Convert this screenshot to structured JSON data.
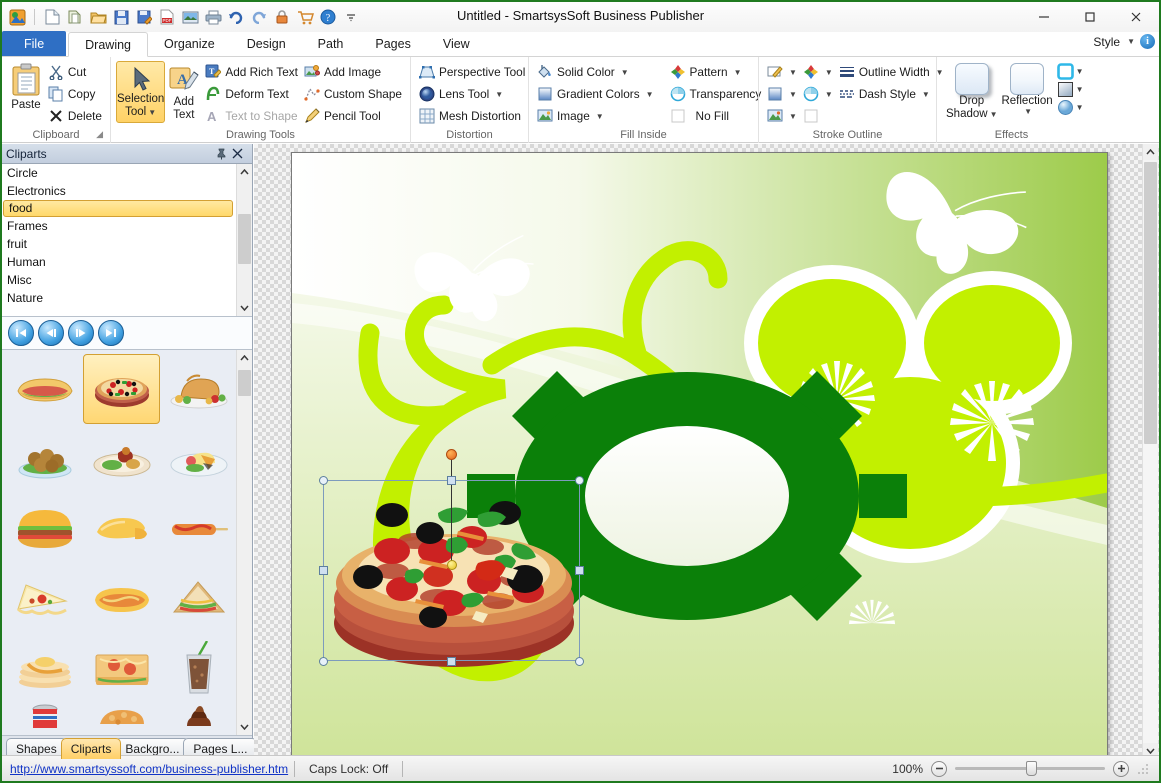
{
  "window": {
    "title": "Untitled - SmartsysSoft Business Publisher",
    "minimize": "—",
    "maximize": "☐",
    "close": "✕"
  },
  "quick_access": {
    "icons": [
      "app-logo-icon",
      "new-document-icon",
      "duplicate-icon",
      "open-folder-icon",
      "save-icon",
      "save-as-icon",
      "export-pdf-icon",
      "export-image-icon",
      "print-icon",
      "undo-icon",
      "redo-icon",
      "lock-icon",
      "cart-icon",
      "help-icon",
      "customize-qat-icon"
    ]
  },
  "ribbon": {
    "tabs": [
      {
        "label": "File",
        "active": false,
        "kind": "file"
      },
      {
        "label": "Drawing",
        "active": true,
        "kind": "normal"
      },
      {
        "label": "Organize",
        "active": false,
        "kind": "normal"
      },
      {
        "label": "Design",
        "active": false,
        "kind": "normal"
      },
      {
        "label": "Path",
        "active": false,
        "kind": "normal"
      },
      {
        "label": "Pages",
        "active": false,
        "kind": "normal"
      },
      {
        "label": "View",
        "active": false,
        "kind": "normal"
      }
    ],
    "style_label": "Style",
    "groups": {
      "clipboard": {
        "title": "Clipboard",
        "paste": "Paste",
        "cut": "Cut",
        "copy": "Copy",
        "delete": "Delete"
      },
      "drawing_tools": {
        "title": "Drawing Tools",
        "selection_tool": "Selection\nTool",
        "selection_tool_line1": "Selection",
        "selection_tool_line2": "Tool",
        "add_text_line1": "Add",
        "add_text_line2": "Text",
        "add_rich_text": "Add Rich Text",
        "deform_text": "Deform Text",
        "text_to_shape": "Text to Shape",
        "add_image": "Add Image",
        "custom_shape": "Custom Shape",
        "pencil_tool": "Pencil Tool"
      },
      "distortion": {
        "title": "Distortion",
        "perspective_tool": "Perspective Tool",
        "lens_tool": "Lens Tool",
        "mesh_distortion": "Mesh Distortion"
      },
      "fill_inside": {
        "title": "Fill Inside",
        "solid_color": "Solid Color",
        "gradient_colors": "Gradient Colors",
        "image": "Image",
        "pattern": "Pattern",
        "transparency": "Transparency",
        "no_fill": "No Fill"
      },
      "stroke_outline": {
        "title": "Stroke Outline",
        "outline_width": "Outline Width",
        "dash_style": "Dash Style"
      },
      "effects": {
        "title": "Effects",
        "drop_shadow_line1": "Drop",
        "drop_shadow_line2": "Shadow",
        "reflection": "Reflection"
      }
    }
  },
  "cliparts_panel": {
    "header_title": "Cliparts",
    "pin_icon": "ᵀ",
    "close_icon": "✕",
    "categories": [
      {
        "label": "Circle",
        "selected": false
      },
      {
        "label": "Electronics",
        "selected": false
      },
      {
        "label": "food",
        "selected": true
      },
      {
        "label": "Frames",
        "selected": false
      },
      {
        "label": "fruit",
        "selected": false
      },
      {
        "label": "Human",
        "selected": false
      },
      {
        "label": "Misc",
        "selected": false
      },
      {
        "label": "Nature",
        "selected": false
      }
    ],
    "nav_buttons": [
      "first-page-icon",
      "previous-page-icon",
      "next-page-icon",
      "last-page-icon"
    ],
    "thumbnails": [
      {
        "name": "sub-sandwich-clipart",
        "selected": false
      },
      {
        "name": "pizza-clipart",
        "selected": true
      },
      {
        "name": "roast-turkey-clipart",
        "selected": false
      },
      {
        "name": "meatballs-salad-clipart",
        "selected": false
      },
      {
        "name": "roast-dinner-plate-clipart",
        "selected": false
      },
      {
        "name": "dessert-plate-clipart",
        "selected": false
      },
      {
        "name": "hamburger-clipart",
        "selected": false
      },
      {
        "name": "croissant-clipart",
        "selected": false
      },
      {
        "name": "corn-dog-clipart",
        "selected": false
      },
      {
        "name": "pizza-slice-clipart",
        "selected": false
      },
      {
        "name": "hot-dog-clipart",
        "selected": false
      },
      {
        "name": "club-sandwich-clipart",
        "selected": false
      },
      {
        "name": "pancakes-clipart",
        "selected": false
      },
      {
        "name": "open-sandwich-clipart",
        "selected": false
      },
      {
        "name": "iced-drink-clipart",
        "selected": false
      },
      {
        "name": "soda-can-clipart",
        "selected": false
      },
      {
        "name": "fried-food-clipart",
        "selected": false
      },
      {
        "name": "chocolate-swirl-clipart",
        "selected": false
      }
    ],
    "tabs": [
      {
        "label": "Shapes",
        "active": false
      },
      {
        "label": "Cliparts",
        "active": true
      },
      {
        "label": "Backgro...",
        "active": false
      },
      {
        "label": "Pages L...",
        "active": false
      }
    ]
  },
  "canvas": {
    "selected_object": "pizza-clipart",
    "background_theme": "green-floral-butterfly-template",
    "gear_color": "#0b8009",
    "accent_green": "#c2f000",
    "banner_green": "#96c83c"
  },
  "status": {
    "link": "http://www.smartsyssoft.com/business-publisher.htm",
    "caps_lock": "Caps Lock: Off",
    "zoom_percent": "100%",
    "zoom_out_icon": "−",
    "zoom_in_icon": "+"
  }
}
